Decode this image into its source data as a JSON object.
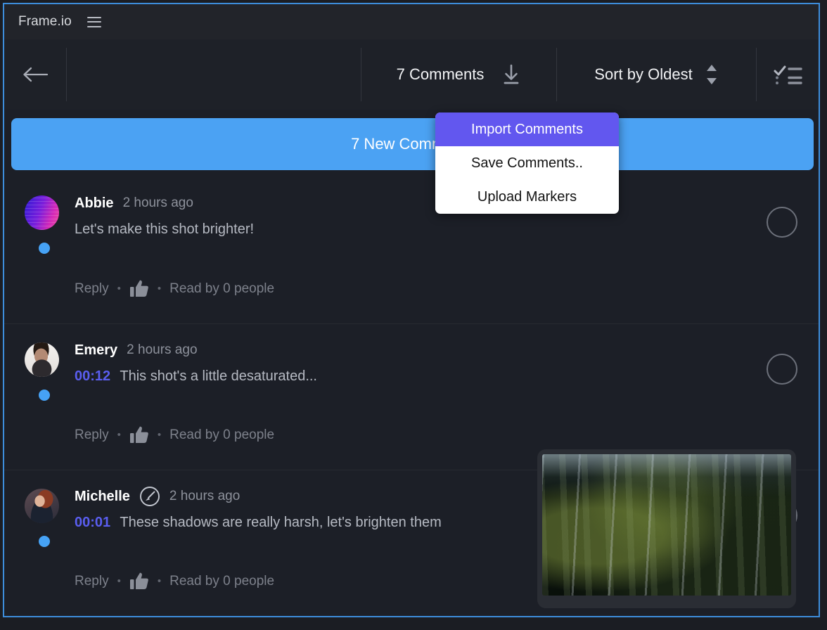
{
  "window": {
    "accent_border_color": "#3d8ddb"
  },
  "title_bar": {
    "brand": "Frame.io",
    "menu_icon": "hamburger-icon"
  },
  "toolbar": {
    "back_icon": "back-arrow-icon",
    "comment_count_label": "7 Comments",
    "download_icon": "download-icon",
    "sort_label": "Sort by Oldest",
    "sort_stepper_icon": "stepper-updown-icon",
    "checklist_icon": "checklist-icon"
  },
  "banner": {
    "label": "7 New Comments"
  },
  "import_menu": {
    "items": [
      {
        "label": "Import Comments",
        "highlighted": true
      },
      {
        "label": "Save Comments..",
        "highlighted": false
      },
      {
        "label": "Upload Markers",
        "highlighted": false
      }
    ],
    "highlight_color": "#6257ef",
    "background_color": "#ffffff"
  },
  "comments": [
    {
      "author": "Abbie",
      "time_ago": "2 hours ago",
      "timecode": "",
      "text": "Let's make this shot brighter!",
      "reply_label": "Reply",
      "read_label": "Read by 0 people",
      "has_annotation_icon": false,
      "unread": true
    },
    {
      "author": "Emery",
      "time_ago": "2 hours ago",
      "timecode": "00:12",
      "text": "This shot's a little desaturated...",
      "reply_label": "Reply",
      "read_label": "Read by 0 people",
      "has_annotation_icon": false,
      "unread": true
    },
    {
      "author": "Michelle",
      "time_ago": "2 hours ago",
      "timecode": "00:01",
      "text": "These shadows are really harsh, let's brighten them",
      "reply_label": "Reply",
      "read_label": "Read by 0 people",
      "has_annotation_icon": true,
      "unread": true
    }
  ],
  "video_thumbnail": {
    "alt": "dark forest with tall trees"
  },
  "separators": {
    "bullet": "•"
  },
  "colors": {
    "timecode": "#5a5ef0",
    "unread_dot": "#46a2f5",
    "banner": "#4ba2f3"
  }
}
